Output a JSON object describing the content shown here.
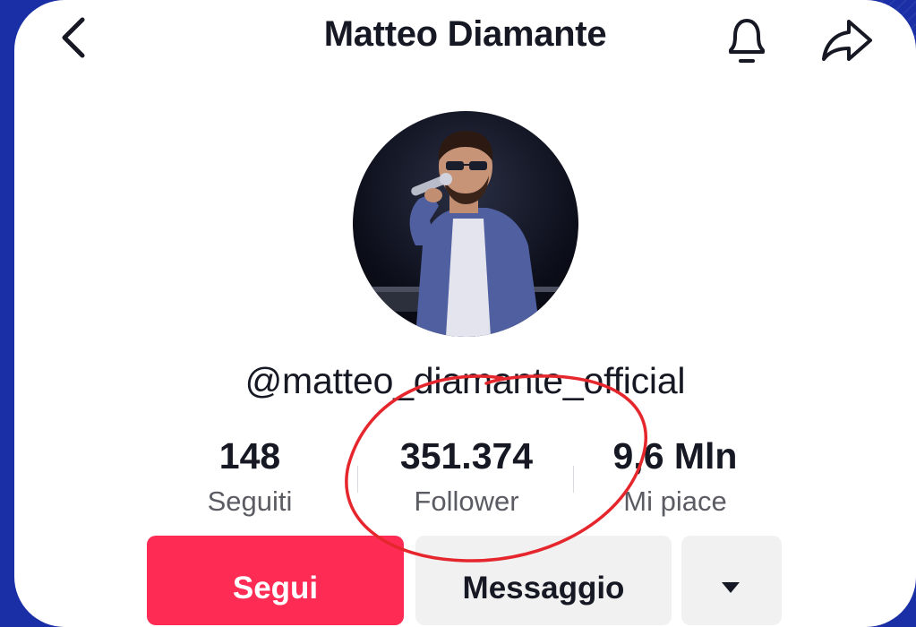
{
  "profile": {
    "display_name": "Matteo Diamante",
    "handle": "@matteo_diamante_official"
  },
  "stats": [
    {
      "value": "148",
      "label": "Seguiti"
    },
    {
      "value": "351.374",
      "label": "Follower"
    },
    {
      "value": "9,6 Mln",
      "label": "Mi piace"
    }
  ],
  "actions": {
    "follow_label": "Segui",
    "message_label": "Messaggio"
  },
  "icons": {
    "back": "chevron-left-icon",
    "notifications": "bell-icon",
    "share": "share-arrow-icon",
    "more": "caret-down-icon"
  },
  "colors": {
    "background": "#1a2fa6",
    "follow": "#fe2c55",
    "annotation": "#e5262c"
  }
}
